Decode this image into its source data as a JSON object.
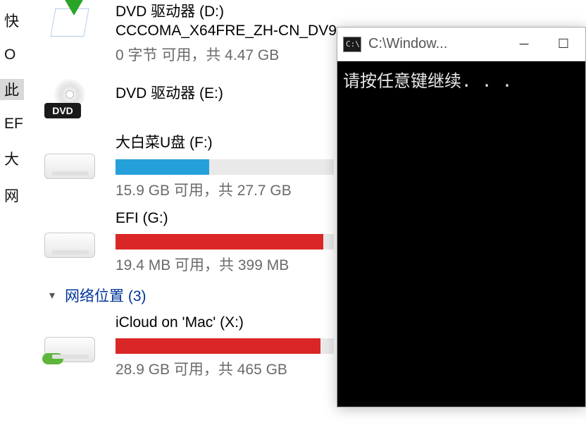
{
  "sidebar": {
    "items": [
      {
        "label": "快"
      },
      {
        "label": "O"
      },
      {
        "label": "此"
      },
      {
        "label": "EF"
      },
      {
        "label": "大"
      },
      {
        "label": "网"
      }
    ]
  },
  "drives": {
    "d": {
      "name": "DVD 驱动器 (D:)",
      "volume": "CCCOMA_X64FRE_ZH-CN_DV9",
      "status": "0 字节 可用，共 4.47 GB"
    },
    "e": {
      "name": "DVD 驱动器 (E:)",
      "dvd_badge": "DVD"
    },
    "f": {
      "name": "大白菜U盘 (F:)",
      "status": "15.9 GB 可用，共 27.7 GB",
      "fill_pct": 43
    },
    "g": {
      "name": "EFI (G:)",
      "status": "19.4 MB 可用，共 399 MB",
      "fill_pct": 95
    },
    "x": {
      "name": "iCloud on 'Mac' (X:)",
      "status": "28.9 GB 可用，共 465 GB",
      "fill_pct": 94
    }
  },
  "section": {
    "network_label": "网络位置 (3)"
  },
  "cmd": {
    "title": "C:\\Window...",
    "body": "请按任意键继续. . .",
    "icon_text": "C:\\"
  }
}
